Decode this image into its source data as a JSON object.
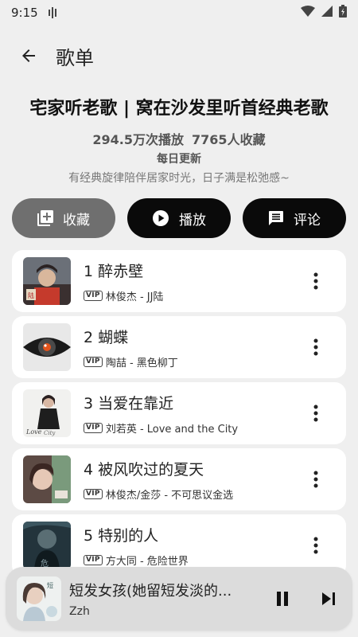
{
  "status_bar": {
    "time": "9:15"
  },
  "app_bar": {
    "title": "歌单"
  },
  "playlist": {
    "title": "宅家听老歌 | 窝在沙发里听首经典老歌",
    "plays": "294.5万次播放",
    "favorites": "7765人收藏",
    "update": "每日更新",
    "description": "有经典旋律陪伴居家时光，日子满是松弛感~"
  },
  "actions": {
    "collect_label": "收藏",
    "play_label": "播放",
    "comment_label": "评论"
  },
  "songs": [
    {
      "num": "1",
      "title": "醉赤壁",
      "badge": "VIP",
      "meta": "林俊杰 - JJ陆"
    },
    {
      "num": "2",
      "title": "蝴蝶",
      "badge": "VIP",
      "meta": "陶喆 - 黑色柳丁"
    },
    {
      "num": "3",
      "title": "当爱在靠近",
      "badge": "VIP",
      "meta": "刘若英 - Love and the City"
    },
    {
      "num": "4",
      "title": "被风吹过的夏天",
      "badge": "VIP",
      "meta": "林俊杰/金莎 - 不可思议金选"
    },
    {
      "num": "5",
      "title": "特别的人",
      "badge": "VIP",
      "meta": "方大同 - 危险世界"
    }
  ],
  "now_playing": {
    "title": "短发女孩(她留短发淡的...",
    "artist": "Zzh"
  },
  "colors": {
    "background": "#efefef",
    "collect_button": "#6f6f6f",
    "primary_button": "#0a0a0a",
    "card": "#ffffff",
    "player": "#dcdcdc"
  }
}
